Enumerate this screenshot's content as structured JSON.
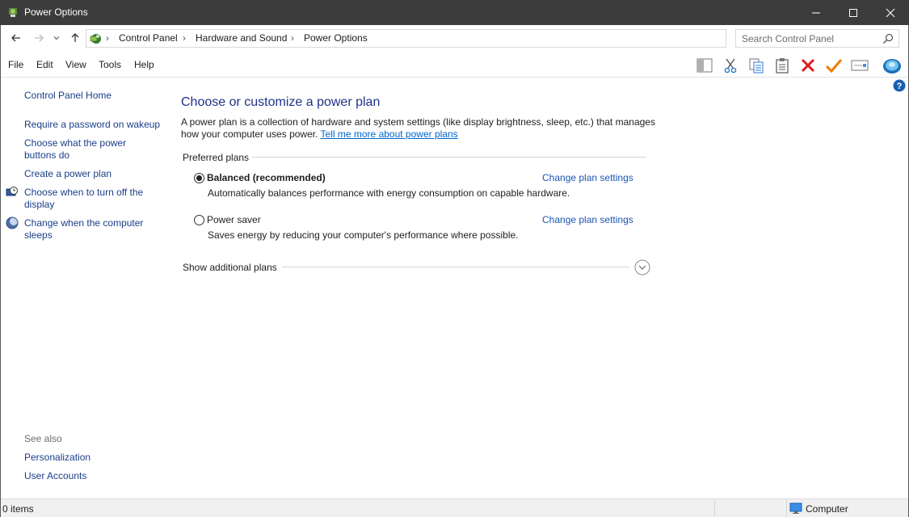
{
  "window": {
    "title": "Power Options",
    "controls": {
      "minimize": "minimize",
      "maximize": "maximize",
      "close": "close"
    }
  },
  "address": {
    "breadcrumb": [
      "Control Panel",
      "Hardware and Sound",
      "Power Options"
    ],
    "search_placeholder": "Search Control Panel"
  },
  "menu": [
    "File",
    "Edit",
    "View",
    "Tools",
    "Help"
  ],
  "toolbar_icons": [
    "layout-pane-icon",
    "cut-icon",
    "copy-icon",
    "paste-icon",
    "delete-icon",
    "check-icon",
    "properties-icon",
    "shell-icon"
  ],
  "sidebar": {
    "home": "Control Panel Home",
    "links": [
      "Require a password on wakeup",
      "Choose what the power buttons do",
      "Create a power plan",
      "Choose when to turn off the display",
      "Change when the computer sleeps"
    ],
    "see_also_heading": "See also",
    "see_also": [
      "Personalization",
      "User Accounts"
    ]
  },
  "main": {
    "title": "Choose or customize a power plan",
    "intro_text": "A power plan is a collection of hardware and system settings (like display brightness, sleep, etc.) that manages how your computer uses power.",
    "intro_link": "Tell me more about power plans",
    "preferred_label": "Preferred plans",
    "plans": [
      {
        "name": "Balanced (recommended)",
        "selected": true,
        "description": "Automatically balances performance with energy consumption on capable hardware.",
        "link": "Change plan settings"
      },
      {
        "name": "Power saver",
        "selected": false,
        "description": "Saves energy by reducing your computer's performance where possible.",
        "link": "Change plan settings"
      }
    ],
    "additional_label": "Show additional plans"
  },
  "status": {
    "items": "0 items",
    "zone": "Computer"
  },
  "colors": {
    "titlebar": "#3c3c3c",
    "link": "#1a3e8a",
    "title": "#1e3287",
    "delete": "#d81e1e",
    "check": "#f07c00"
  }
}
